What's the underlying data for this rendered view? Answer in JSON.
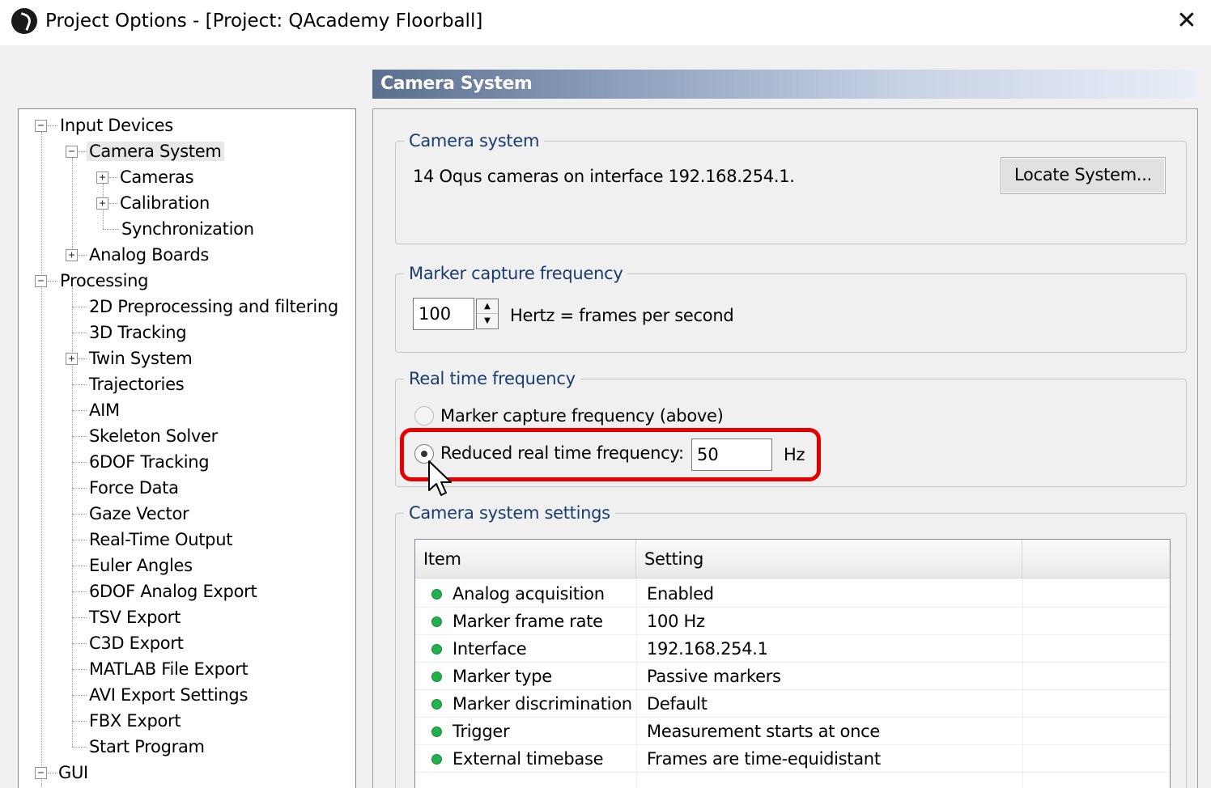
{
  "window": {
    "title": "Project Options - [Project: QAcademy Floorball]",
    "close_glyph": "✕"
  },
  "tree": {
    "input_devices": "Input Devices",
    "camera_system": "Camera System",
    "cameras": "Cameras",
    "calibration": "Calibration",
    "synchronization": "Synchronization",
    "analog_boards": "Analog Boards",
    "processing": "Processing",
    "preprocessing": "2D Preprocessing and filtering",
    "tracking_3d": "3D Tracking",
    "twin_system": "Twin System",
    "trajectories": "Trajectories",
    "aim": "AIM",
    "skeleton_solver": "Skeleton Solver",
    "tracking_6dof": "6DOF Tracking",
    "force_data": "Force Data",
    "gaze_vector": "Gaze Vector",
    "realtime_output": "Real-Time Output",
    "euler_angles": "Euler Angles",
    "analog_export_6dof": "6DOF Analog Export",
    "tsv_export": "TSV Export",
    "c3d_export": "C3D Export",
    "matlab_export": "MATLAB File Export",
    "avi_export": "AVI Export Settings",
    "fbx_export": "FBX Export",
    "start_program": "Start Program",
    "gui": "GUI",
    "expand_minus": "−",
    "expand_plus": "+"
  },
  "panel": {
    "header": "Camera System",
    "camera_group": {
      "title": "Camera system",
      "status": "14 Oqus cameras on interface 192.168.254.1.",
      "locate_button": "Locate System..."
    },
    "marker_group": {
      "title": "Marker capture frequency",
      "value": "100",
      "unit_text": "Hertz = frames per second",
      "up_glyph": "▲",
      "down_glyph": "▼"
    },
    "realtime_group": {
      "title": "Real time frequency",
      "option_marker": "Marker capture frequency (above)",
      "option_reduced": "Reduced real time frequency:",
      "reduced_value": "50",
      "reduced_unit": "Hz",
      "selected": "reduced"
    },
    "settings_group": {
      "title": "Camera system settings",
      "columns": [
        "Item",
        "Setting"
      ],
      "rows": [
        {
          "item": "Analog acquisition",
          "setting": "Enabled"
        },
        {
          "item": "Marker frame rate",
          "setting": "100 Hz"
        },
        {
          "item": "Interface",
          "setting": "192.168.254.1"
        },
        {
          "item": "Marker type",
          "setting": "Passive markers"
        },
        {
          "item": "Marker discrimination",
          "setting": "Default"
        },
        {
          "item": "Trigger",
          "setting": "Measurement starts at once"
        },
        {
          "item": "External timebase",
          "setting": "Frames are time-equidistant"
        }
      ]
    }
  },
  "colors": {
    "highlight": "#e60000",
    "status_dot": "#22b14c",
    "group_title": "#1a3c6e"
  }
}
